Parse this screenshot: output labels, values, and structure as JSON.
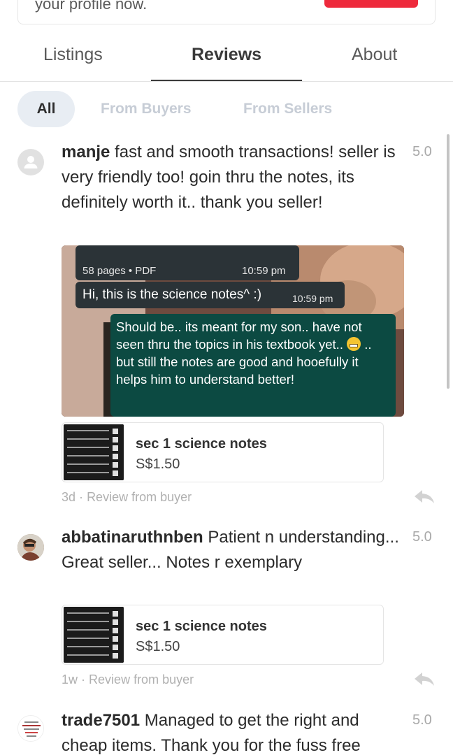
{
  "banner": {
    "text": "your profile now."
  },
  "tabs": [
    {
      "label": "Listings"
    },
    {
      "label": "Reviews"
    },
    {
      "label": "About"
    }
  ],
  "filters": [
    {
      "label": "All"
    },
    {
      "label": "From Buyers"
    },
    {
      "label": "From Sellers"
    }
  ],
  "reviews": [
    {
      "username": "manje",
      "text": "fast and smooth transactions! seller is very friendly too! goin thru the notes, its definitely worth it.. thank you seller!",
      "rating": "5.0",
      "photo": {
        "doc_meta": "58 pages • PDF",
        "doc_time": "10:59 pm",
        "msg1": "Hi, this is the science notes^ :)",
        "msg1_time": "10:59 pm",
        "msg2_a": "Should be.. its meant for my son.. have not seen thru the topics in his textbook yet..",
        "msg2_b": ".. but still the notes are good and hooefully it helps him to understand better!"
      },
      "product": {
        "title": "sec 1 science notes",
        "price": "S$1.50"
      },
      "time": "3d",
      "source": "Review from buyer"
    },
    {
      "username": "abbatinaruthnben",
      "text": "Patient n understanding... Great seller... Notes r exemplary",
      "rating": "5.0",
      "product": {
        "title": "sec 1 science notes",
        "price": "S$1.50"
      },
      "time": "1w",
      "source": "Review from buyer"
    },
    {
      "username": "trade7501",
      "text": "Managed to get the right and cheap items. Thank you for the fuss free",
      "rating": "5.0"
    }
  ],
  "separator": "·",
  "icons": {
    "avatar_default": "user-icon",
    "reply": "reply-icon",
    "emoji": "grimacing-emoji-icon"
  },
  "colors": {
    "accent_red": "#ee2a3c",
    "chat_bubble": "#0c4a42",
    "chip_active_bg": "#e8edf3"
  }
}
